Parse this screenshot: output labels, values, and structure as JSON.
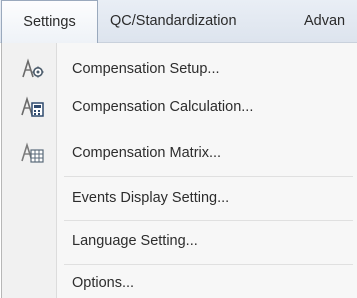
{
  "menubar": {
    "items": [
      {
        "label": "Settings"
      },
      {
        "label": "QC/Standardization"
      },
      {
        "label": "Advan"
      }
    ]
  },
  "settings_menu": {
    "items": [
      {
        "label": "Compensation Setup...",
        "icon": "compensation-setup-icon"
      },
      {
        "label": "Compensation Calculation...",
        "icon": "compensation-calculation-icon"
      },
      {
        "label": "Compensation Matrix...",
        "icon": "compensation-matrix-icon"
      },
      {
        "label": "Events Display Setting..."
      },
      {
        "label": "Language Setting..."
      },
      {
        "label": "Options..."
      }
    ]
  }
}
